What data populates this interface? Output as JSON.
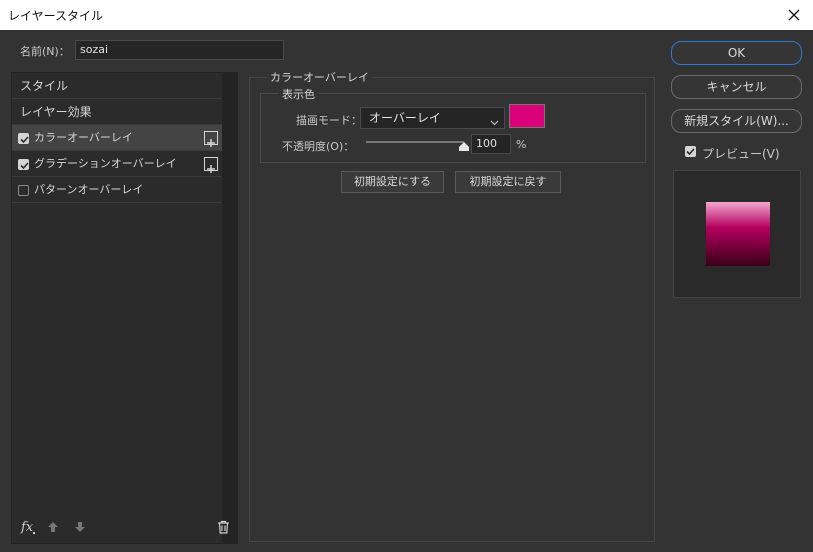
{
  "window": {
    "title": "レイヤースタイル"
  },
  "name_field": {
    "label": "名前(N)：",
    "value": "sozai"
  },
  "left_panel": {
    "items": [
      {
        "label": "スタイル"
      },
      {
        "label": "レイヤー効果"
      },
      {
        "label": "カラーオーバーレイ",
        "checked": true,
        "active": true
      },
      {
        "label": "グラデーションオーバーレイ",
        "checked": true
      },
      {
        "label": "パターンオーバーレイ",
        "checked": false
      }
    ]
  },
  "main": {
    "section_title": "カラーオーバーレイ",
    "group_title": "表示色",
    "blend_mode_label": "描画モード：",
    "blend_mode_value": "オーバーレイ",
    "swatch_color": "#d9007a",
    "opacity_label": "不透明度(O)：",
    "opacity_value": "100",
    "opacity_unit": "%",
    "opacity_level": 1.0,
    "reset_default_button": "初期設定にする",
    "restore_default_button": "初期設定に戻す"
  },
  "right": {
    "ok": "OK",
    "cancel": "キャンセル",
    "new_style": "新規スタイル(W)...",
    "preview_label": "プレビュー(V)",
    "preview_checked": true
  },
  "bottom_icons": [
    "fx-icon",
    "arrow-up-icon",
    "arrow-down-icon",
    "trash-icon"
  ],
  "colors": {
    "accent": "#2f79d8",
    "gradient_top": "#f2a6cf",
    "gradient_mid": "#b4005e",
    "gradient_bottom": "#3a0019"
  }
}
